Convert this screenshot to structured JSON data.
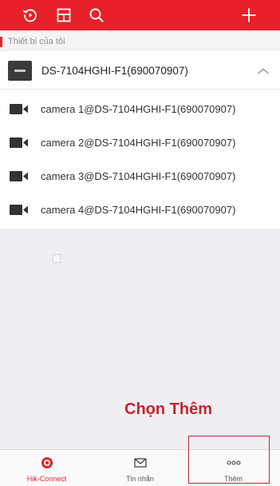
{
  "topbar": {
    "icons": [
      "history-icon",
      "layout-icon",
      "search-icon",
      "add-icon"
    ]
  },
  "section": {
    "title": "Thiết bị của tôi"
  },
  "device": {
    "name": "DS-7104HGHI-F1(690070907)"
  },
  "cameras": [
    {
      "name": "camera 1@DS-7104HGHI-F1(690070907)"
    },
    {
      "name": "camera 2@DS-7104HGHI-F1(690070907)"
    },
    {
      "name": "camera 3@DS-7104HGHI-F1(690070907)"
    },
    {
      "name": "camera 4@DS-7104HGHI-F1(690070907)"
    }
  ],
  "annotation": {
    "text": "Chọn Thêm"
  },
  "bottom_nav": {
    "items": [
      {
        "label": "Hik-Connect",
        "icon": "hik-connect-icon",
        "active": true
      },
      {
        "label": "Tin nhắn",
        "icon": "message-icon",
        "active": false
      },
      {
        "label": "Thêm",
        "icon": "more-icon",
        "active": false
      }
    ]
  },
  "colors": {
    "brand": "#e8202a",
    "annotation": "#c0272d"
  }
}
